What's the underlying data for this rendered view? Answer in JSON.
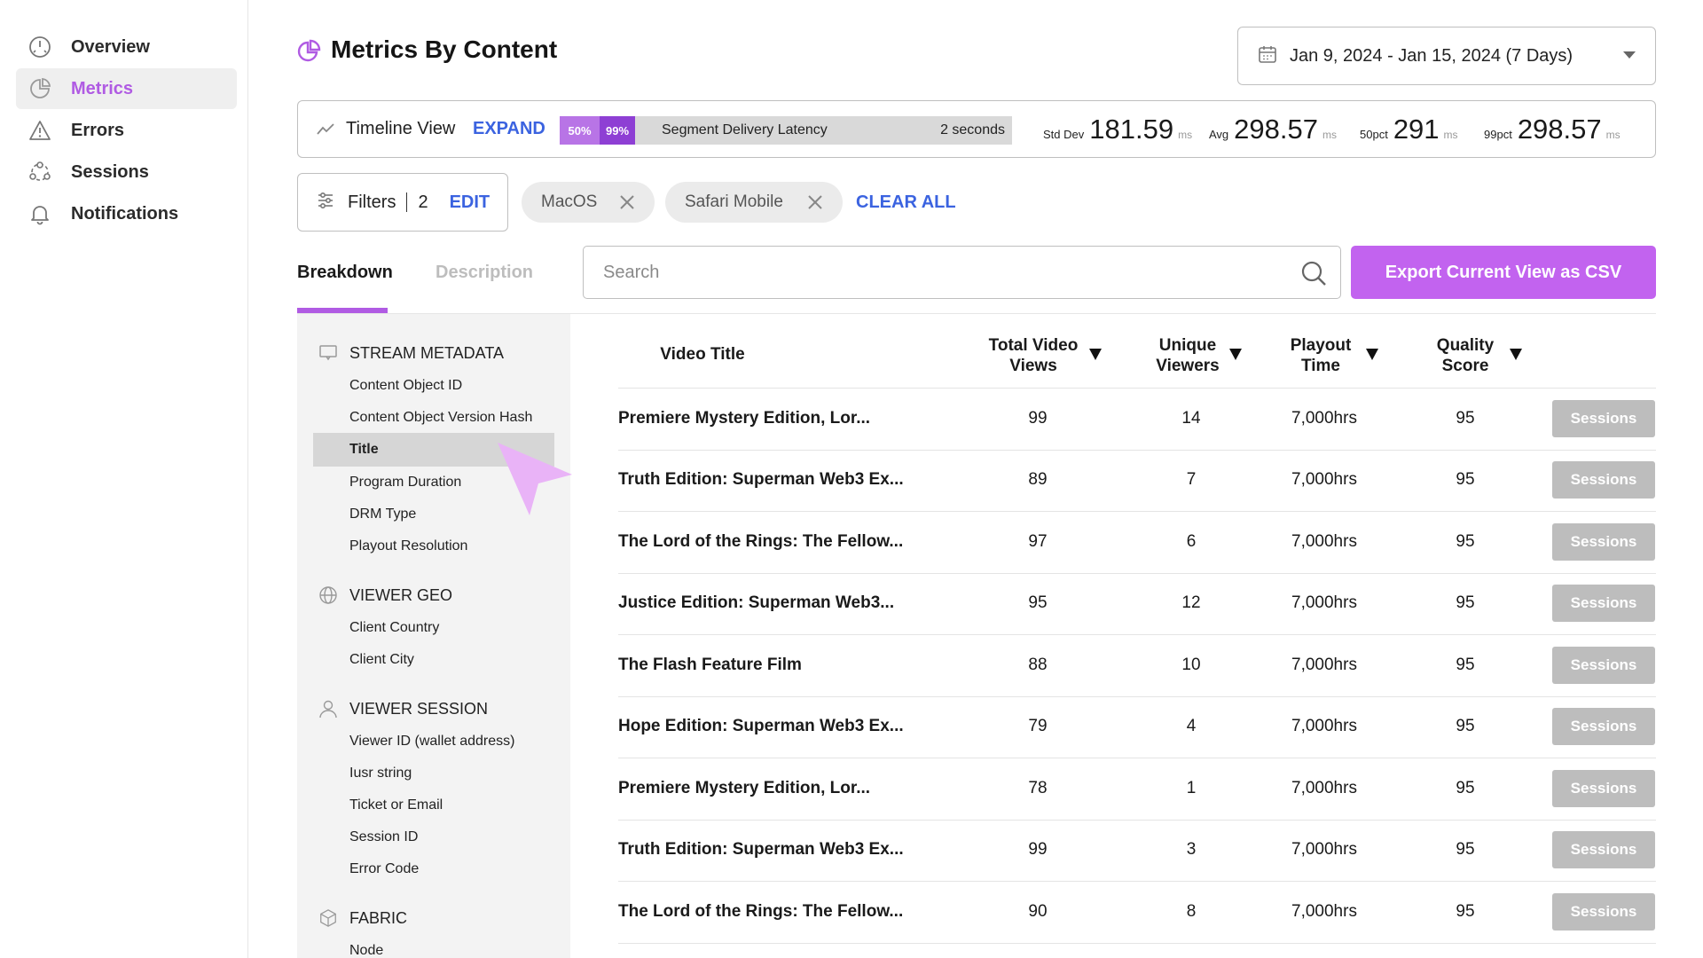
{
  "sidebar": {
    "items": [
      {
        "label": "Overview",
        "icon": "gauge-icon",
        "active": false
      },
      {
        "label": "Metrics",
        "icon": "pie-chart-icon",
        "active": true
      },
      {
        "label": "Errors",
        "icon": "warning-icon",
        "active": false
      },
      {
        "label": "Sessions",
        "icon": "sessions-icon",
        "active": false
      },
      {
        "label": "Notifications",
        "icon": "bell-icon",
        "active": false
      }
    ]
  },
  "header": {
    "title": "Metrics By Content",
    "date_range": "Jan 9, 2024 - Jan 15, 2024 (7 Days)"
  },
  "stats": {
    "timeline_label": "Timeline View",
    "expand_label": "EXPAND",
    "latency": {
      "p50": "50%",
      "p99": "99%",
      "name": "Segment Delivery Latency",
      "value": "2 seconds"
    },
    "std_dev": {
      "label": "Std Dev",
      "value": "181.59",
      "unit": "ms"
    },
    "avg": {
      "label": "Avg",
      "value": "298.57",
      "unit": "ms"
    },
    "p50": {
      "label": "50pct",
      "value": "291",
      "unit": "ms"
    },
    "p99": {
      "label": "99pct",
      "value": "298.57",
      "unit": "ms"
    }
  },
  "filters": {
    "label": "Filters",
    "count": "2",
    "edit_label": "EDIT",
    "chips": [
      "MacOS",
      "Safari Mobile"
    ],
    "clear_all_label": "CLEAR ALL"
  },
  "tabs": {
    "breakdown": "Breakdown",
    "description": "Description"
  },
  "search": {
    "placeholder": "Search",
    "value": ""
  },
  "export_label": "Export Current View as CSV",
  "dimensions": {
    "stream_metadata": {
      "label": "STREAM METADATA",
      "items": [
        "Content Object ID",
        "Content Object Version Hash",
        "Title",
        "Program Duration",
        "DRM Type",
        "Playout Resolution"
      ]
    },
    "viewer_geo": {
      "label": "VIEWER GEO",
      "items": [
        "Client Country",
        "Client City"
      ]
    },
    "viewer_session": {
      "label": "VIEWER SESSION",
      "items": [
        "Viewer ID (wallet address)",
        "Iusr string",
        "Ticket or Email",
        "Session ID",
        "Error Code"
      ]
    },
    "fabric": {
      "label": "FABRIC",
      "items": [
        "Node"
      ]
    },
    "selected": "Title"
  },
  "table": {
    "columns": {
      "title": "Video Title",
      "views_line1": "Total Video",
      "views_line2": "Views",
      "viewers_line1": "Unique",
      "viewers_line2": "Viewers",
      "playout_line1": "Playout",
      "playout_line2": "Time",
      "quality_line1": "Quality",
      "quality_line2": "Score"
    },
    "action_label": "Sessions",
    "rows": [
      {
        "title": "Premiere Mystery Edition, Lor...",
        "views": "99",
        "viewers": "14",
        "playout": "7,000hrs",
        "quality": "95"
      },
      {
        "title": "Truth Edition: Superman Web3 Ex...",
        "views": "89",
        "viewers": "7",
        "playout": "7,000hrs",
        "quality": "95"
      },
      {
        "title": "The Lord of the Rings: The Fellow...",
        "views": "97",
        "viewers": "6",
        "playout": "7,000hrs",
        "quality": "95"
      },
      {
        "title": "Justice Edition: Superman Web3...",
        "views": "95",
        "viewers": "12",
        "playout": "7,000hrs",
        "quality": "95"
      },
      {
        "title": "The Flash Feature Film",
        "views": "88",
        "viewers": "10",
        "playout": "7,000hrs",
        "quality": "95"
      },
      {
        "title": "Hope Edition: Superman Web3 Ex...",
        "views": "79",
        "viewers": "4",
        "playout": "7,000hrs",
        "quality": "95"
      },
      {
        "title": "Premiere Mystery Edition, Lor...",
        "views": "78",
        "viewers": "1",
        "playout": "7,000hrs",
        "quality": "95"
      },
      {
        "title": "Truth Edition: Superman Web3 Ex...",
        "views": "99",
        "viewers": "3",
        "playout": "7,000hrs",
        "quality": "95"
      },
      {
        "title": "The Lord of the Rings: The Fellow...",
        "views": "90",
        "viewers": "8",
        "playout": "7,000hrs",
        "quality": "95"
      }
    ]
  },
  "colors": {
    "accent": "#b05be3",
    "link": "#3b63e0",
    "export_button": "#c263ef",
    "sessions_button": "#bdbdbd",
    "cursor": "#e9b3f7"
  }
}
